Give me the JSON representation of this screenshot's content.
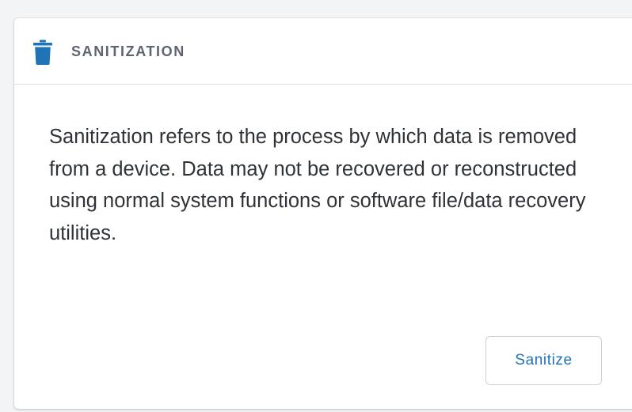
{
  "panel": {
    "icon": "trash-icon",
    "title": "SANITIZATION",
    "description": "Sanitization refers to the process by which data is removed from a device. Data may not be recovered or reconstructed using normal system functions or software file/data recovery utilities.",
    "button_label": "Sanitize"
  },
  "colors": {
    "accent": "#1f73b7",
    "title": "#5f6570",
    "text": "#2f3338",
    "border": "#dcdfe3"
  }
}
